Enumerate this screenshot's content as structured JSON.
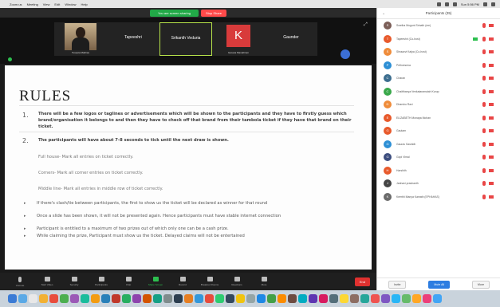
{
  "menubar": {
    "apple": "",
    "items": [
      "Zoom.us",
      "Meeting",
      "View",
      "Edit",
      "Window",
      "Help"
    ],
    "clock": "Sun 5:56 PM"
  },
  "titlebar": {
    "share_label": "You are screen sharing",
    "stop_label": "Stop Share"
  },
  "video_strip": {
    "tiles": [
      {
        "name": "",
        "sub": "Tuseeta Mathias"
      },
      {
        "name": "Tapeeshri",
        "sub": ""
      },
      {
        "name": "Srikanth Veduria",
        "sub": ""
      },
      {
        "name": "",
        "sub": "Gweeta Manathram",
        "letter": "K"
      },
      {
        "name": "Gaunder",
        "sub": ""
      }
    ]
  },
  "document": {
    "title": "RULES",
    "item1_num": "1.",
    "item1_text": "There will be a few logos or taglines or advertisements which will be shown to the participants and they have to firstly guess which brand/organisation it belongs to and then they have to check off that brand from their tambola ticket if they have that brand on their ticket.",
    "item2_num": "2.",
    "item2_text": "The participants will have about 7-8 seconds to tick until the next draw is shown.",
    "sub1": "Full house- Mark all entries on ticket correctly.",
    "sub2": "Corners- Mark all corner entries on ticket correctly.",
    "sub3": "Middle line- Mark all entries in middle row of ticket correctly.",
    "bullets": [
      "If there's clash/tie between participants, the first to show us the ticket will be declared as winner for that round",
      "Once a slide has been shown, it will not be presented again. Hence participants must have stable internet connection",
      "Participant is entitled to a maximum of two prizes out of which only one can be a cash prize.",
      "While claiming the prize, Participant must show us the ticket. Delayed claims will not be entertained"
    ]
  },
  "toolbar": {
    "buttons": [
      "Unmute",
      "Start Video",
      "Security",
      "Participants",
      "Chat",
      "Share Screen",
      "Record",
      "Breakout Rooms",
      "Reactions",
      "More"
    ],
    "end_label": "End"
  },
  "participants_panel": {
    "title": "Participants (35)",
    "people": [
      {
        "name": "Swetha Mugunt Srinath (me)",
        "initial": "S",
        "color": "#7b5e57"
      },
      {
        "name": "Tapeeshri (Co-host)",
        "initial": "T",
        "color": "#e85a2c"
      },
      {
        "name": "Shraavvi Kalpa (Co-host)",
        "initial": "S",
        "color": "#ef8c3a"
      },
      {
        "name": "Prithvesena",
        "initial": "P",
        "color": "#2d8fd5"
      },
      {
        "name": "Charan",
        "initial": "C",
        "color": "#3d6e8f"
      },
      {
        "name": "Chaitthanya Venkataramaiah Kurup",
        "initial": "C",
        "color": "#39a84a"
      },
      {
        "name": "Dharshu Ravi",
        "initial": "D",
        "color": "#ef8c3a"
      },
      {
        "name": "ELIZABETH Monapa Mohan",
        "initial": "E",
        "color": "#e85a2c"
      },
      {
        "name": "Gautam",
        "initial": "G",
        "color": "#e85a2c"
      },
      {
        "name": "Gaurav Sashidh",
        "initial": "G",
        "color": "#2d8fd5"
      },
      {
        "name": "Gopi Vimal",
        "initial": "G",
        "color": "#3d4e7f"
      },
      {
        "name": "Harshith",
        "initial": "H",
        "color": "#e85a2c"
      },
      {
        "name": "Janhavi prashanth",
        "initial": "J",
        "color": "#444444"
      },
      {
        "name": "Keerthi Manya Kamath (EPHAHAS)",
        "initial": "K",
        "color": "#6b6b6b"
      }
    ],
    "footer": [
      "Invite",
      "Mute All",
      "More"
    ]
  }
}
